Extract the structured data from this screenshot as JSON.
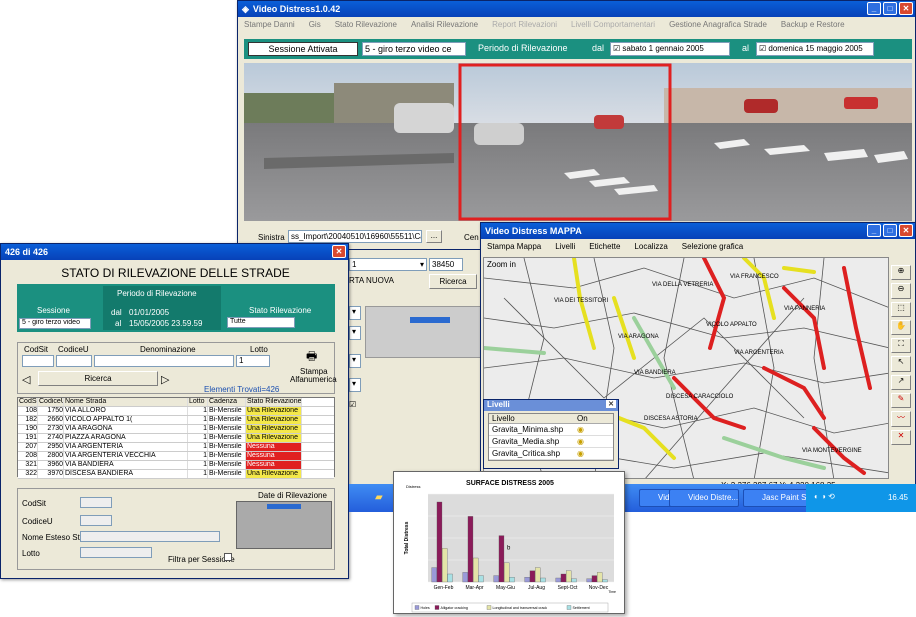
{
  "main": {
    "title": "Video Distress1.0.42",
    "menu": [
      "Stampe Danni",
      "Gis",
      "Stato Rilevazione",
      "Analisi Rilevazione",
      "Report Rilevazioni",
      "Livelli Comportamentari",
      "Gestione Anagrafica Strade",
      "Backup e Restore"
    ],
    "session_label": "Sessione Attivata",
    "session_value": "5 - giro terzo video ce",
    "period_label": "Periodo di Rilevazione",
    "dal_label": "dal",
    "date_from": "sabato    1 gennaio 2005",
    "al_label": "al",
    "date_to": "domenica 15  maggio  2005",
    "sinistra_label": "Sinistra",
    "sinistra_value": "ss_Import\\20040510\\16960\\55511\\Cam_1",
    "browse_label": "...",
    "cen_label": "Cen"
  },
  "stato": {
    "title": "426 di 426",
    "heading": "STATO DI RILEVAZIONE DELLE STRADE",
    "periodo_label": "Periodo di Rilevazione",
    "sessione_label": "Sessione",
    "stato_label": "Stato Rilevazione",
    "dal_label": "dal",
    "al_label": "al",
    "dal_value": "01/01/2005",
    "al_value": "15/05/2005 23.59.59",
    "sessione_value": "5 - giro terzo video",
    "stato_value": "Tutte",
    "filter_labels": {
      "codsit": "CodSit",
      "codiceu": "CodiceU",
      "denominazione": "Denominazione",
      "lotto": "Lotto"
    },
    "lotto_value": "1",
    "ricerca_label": "Ricerca",
    "stampa_label": "Stampa",
    "stampa_label2": "Alfanumerica",
    "trovati": "Elementi Trovati=426",
    "columns": [
      "CodSit",
      "CodiceU",
      "Nome Strada",
      "Lotto",
      "Cadenza",
      "Stato Rilevazione"
    ],
    "rows": [
      [
        "108",
        "1750",
        "VIA ALLORO",
        "1",
        "Bi-Mensile",
        "Una Rilevazione",
        "y"
      ],
      [
        "182",
        "2660",
        "VICOLO APPALTO 1(",
        "1",
        "Bi-Mensile",
        "Una Rilevazione",
        "y"
      ],
      [
        "190",
        "2730",
        "VIA ARAGONA",
        "1",
        "Bi-Mensile",
        "Una Rilevazione",
        "y"
      ],
      [
        "191",
        "2740",
        "PIAZZA ARAGONA",
        "1",
        "Bi-Mensile",
        "Una Rilevazione",
        "y"
      ],
      [
        "207",
        "2950",
        "VIA ARGENTERIA",
        "1",
        "Bi-Mensile",
        "Nessuna",
        "r"
      ],
      [
        "208",
        "2800",
        "VIA ARGENTERIA VECCHIA",
        "1",
        "Bi-Mensile",
        "Nessuna",
        "r"
      ],
      [
        "321",
        "3960",
        "VIA BANDIERA",
        "1",
        "Bi-Mensile",
        "Nessuna",
        "r"
      ],
      [
        "322",
        "3970",
        "DISCESA BANDIERA",
        "1",
        "Bi-Mensile",
        "Una Rilevazione",
        "y"
      ]
    ],
    "detail_labels": {
      "codsit": "CodSit",
      "codiceu": "CodiceU",
      "nome": "Nome Esteso Strada",
      "lotto": "Lotto"
    },
    "date_rilevazione": "Date di Rilevazione",
    "filtra": "Filtra per Sessione"
  },
  "mid": {
    "combo_value": "1",
    "num_value": "38450",
    "carta_label": "RTA NUOVA",
    "ricerca_label": "Ricerca"
  },
  "map": {
    "title": "Video Distress MAPPA",
    "menu": [
      "Stampa Mappa",
      "Livelli",
      "Etichette",
      "Localizza",
      "Selezione grafica"
    ],
    "zoom_label": "Zoom in",
    "coords": "X: 2.376.397,67  Y: 4.220.168,35",
    "street_labels": [
      "VICOLO APPALTO",
      "VIA DELLA VETRERIA",
      "VIA ARGENTERIA",
      "VIA PANNERIA",
      "DISCESA CARACCIOLO",
      "VIA DEI TESSITORI",
      "VIA BANDIERA",
      "VIA MONTEVERGINE",
      "VIA ARAGONA",
      "DISCESA ASTORIA",
      "VIA FRANCESCO"
    ],
    "livelli": {
      "title": "Livelli",
      "col_livello": "Livello",
      "col_on": "On",
      "items": [
        "Gravita_Minima.shp",
        "Gravita_Media.shp",
        "Gravita_Critica.shp"
      ]
    }
  },
  "taskbar": {
    "tasks": [
      "Video Distre...",
      "Video Distre...",
      "Jasc Paint S..."
    ],
    "clock": "16.45"
  },
  "chart_data": {
    "type": "bar",
    "title": "SURFACE DISTRESS 2005",
    "ylabel": "Total Distress",
    "ylabel_small": "Distress",
    "xlabel": "Time",
    "categories": [
      "Gen-Feb",
      "Mar-Apr",
      "May-Giu",
      "Jul-Aug",
      "Sept-Oct",
      "Nov-Dec"
    ],
    "series": [
      {
        "name": "Holes",
        "values": [
          18,
          12,
          8,
          6,
          5,
          4
        ]
      },
      {
        "name": "Alligator cracking",
        "values": [
          100,
          82,
          58,
          14,
          10,
          8
        ]
      },
      {
        "name": "Longitudinal and transversal crack",
        "values": [
          42,
          30,
          24,
          18,
          14,
          12
        ]
      },
      {
        "name": "Settlement",
        "values": [
          10,
          8,
          6,
          5,
          4,
          3
        ]
      }
    ],
    "annotation": "b",
    "ylim": [
      0,
      110
    ],
    "colors": [
      "#9a9ad8",
      "#8b1b5a",
      "#e4e4a8",
      "#a8e0e4"
    ],
    "grid": true,
    "legend": "bottom"
  }
}
